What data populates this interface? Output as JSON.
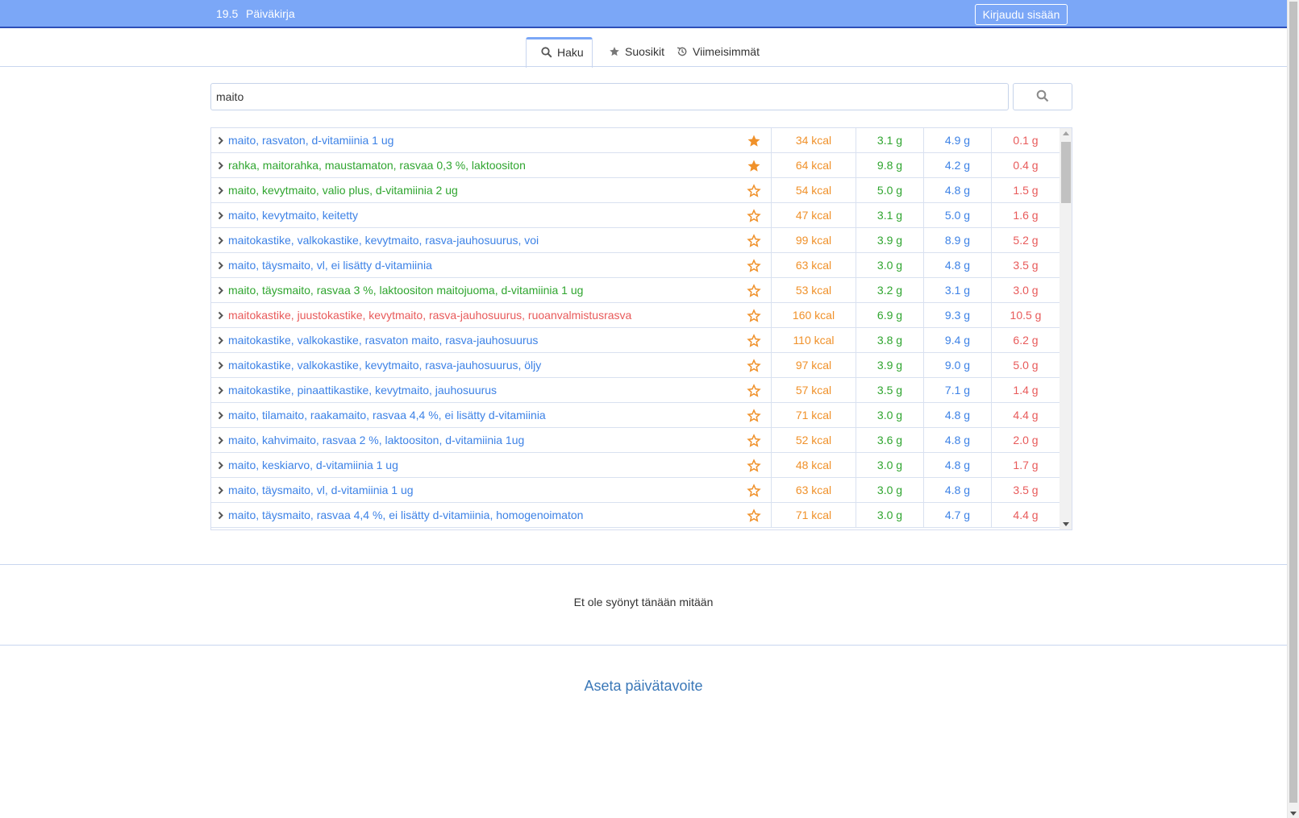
{
  "header": {
    "date": "19.5",
    "title": "Päiväkirja",
    "login_label": "Kirjaudu sisään"
  },
  "tabs": [
    {
      "label": "Haku",
      "icon": "search-icon",
      "active": true
    },
    {
      "label": "Suosikit",
      "icon": "star-icon",
      "active": false
    },
    {
      "label": "Viimeisimmät",
      "icon": "history-icon",
      "active": false
    }
  ],
  "search": {
    "value": "maito"
  },
  "results": [
    {
      "name": "maito, rasvaton, d-vitamiinia 1 ug",
      "color": "blue",
      "favorite": true,
      "kcal": "34 kcal",
      "protein": "3.1 g",
      "carbs": "4.9 g",
      "fat": "0.1 g"
    },
    {
      "name": "rahka, maitorahka, maustamaton, rasvaa 0,3 %, laktoositon",
      "color": "green",
      "favorite": true,
      "kcal": "64 kcal",
      "protein": "9.8 g",
      "carbs": "4.2 g",
      "fat": "0.4 g"
    },
    {
      "name": "maito, kevytmaito, valio plus, d-vitamiinia 2 ug",
      "color": "green",
      "favorite": false,
      "kcal": "54 kcal",
      "protein": "5.0 g",
      "carbs": "4.8 g",
      "fat": "1.5 g"
    },
    {
      "name": "maito, kevytmaito, keitetty",
      "color": "blue",
      "favorite": false,
      "kcal": "47 kcal",
      "protein": "3.1 g",
      "carbs": "5.0 g",
      "fat": "1.6 g"
    },
    {
      "name": "maitokastike, valkokastike, kevytmaito, rasva-jauhosuurus, voi",
      "color": "blue",
      "favorite": false,
      "kcal": "99 kcal",
      "protein": "3.9 g",
      "carbs": "8.9 g",
      "fat": "5.2 g"
    },
    {
      "name": "maito, täysmaito, vl, ei lisätty d-vitamiinia",
      "color": "blue",
      "favorite": false,
      "kcal": "63 kcal",
      "protein": "3.0 g",
      "carbs": "4.8 g",
      "fat": "3.5 g"
    },
    {
      "name": "maito, täysmaito, rasvaa 3 %, laktoositon maitojuoma, d-vitamiinia 1 ug",
      "color": "green",
      "favorite": false,
      "kcal": "53 kcal",
      "protein": "3.2 g",
      "carbs": "3.1 g",
      "fat": "3.0 g"
    },
    {
      "name": "maitokastike, juustokastike, kevytmaito, rasva-jauhosuurus, ruoanvalmistusrasva",
      "color": "red",
      "favorite": false,
      "kcal": "160 kcal",
      "protein": "6.9 g",
      "carbs": "9.3 g",
      "fat": "10.5 g"
    },
    {
      "name": "maitokastike, valkokastike, rasvaton maito, rasva-jauhosuurus",
      "color": "blue",
      "favorite": false,
      "kcal": "110 kcal",
      "protein": "3.8 g",
      "carbs": "9.4 g",
      "fat": "6.2 g"
    },
    {
      "name": "maitokastike, valkokastike, kevytmaito, rasva-jauhosuurus, öljy",
      "color": "blue",
      "favorite": false,
      "kcal": "97 kcal",
      "protein": "3.9 g",
      "carbs": "9.0 g",
      "fat": "5.0 g"
    },
    {
      "name": "maitokastike, pinaattikastike, kevytmaito, jauhosuurus",
      "color": "blue",
      "favorite": false,
      "kcal": "57 kcal",
      "protein": "3.5 g",
      "carbs": "7.1 g",
      "fat": "1.4 g"
    },
    {
      "name": "maito, tilamaito, raakamaito, rasvaa 4,4 %, ei lisätty d-vitamiinia",
      "color": "blue",
      "favorite": false,
      "kcal": "71 kcal",
      "protein": "3.0 g",
      "carbs": "4.8 g",
      "fat": "4.4 g"
    },
    {
      "name": "maito, kahvimaito, rasvaa 2 %, laktoositon, d-vitamiinia 1ug",
      "color": "blue",
      "favorite": false,
      "kcal": "52 kcal",
      "protein": "3.6 g",
      "carbs": "4.8 g",
      "fat": "2.0 g"
    },
    {
      "name": "maito, keskiarvo, d-vitamiinia 1 ug",
      "color": "blue",
      "favorite": false,
      "kcal": "48 kcal",
      "protein": "3.0 g",
      "carbs": "4.8 g",
      "fat": "1.7 g"
    },
    {
      "name": "maito, täysmaito, vl, d-vitamiinia 1 ug",
      "color": "blue",
      "favorite": false,
      "kcal": "63 kcal",
      "protein": "3.0 g",
      "carbs": "4.8 g",
      "fat": "3.5 g"
    },
    {
      "name": "maito, täysmaito, rasvaa 4,4 %, ei lisätty d-vitamiinia, homogenoimaton",
      "color": "blue",
      "favorite": false,
      "kcal": "71 kcal",
      "protein": "3.0 g",
      "carbs": "4.7 g",
      "fat": "4.4 g"
    }
  ],
  "diary": {
    "empty_message": "Et ole syönyt tänään mitään",
    "goal_link": "Aseta päivätavoite"
  },
  "colors": {
    "header": "#7ba7f7",
    "kcal": "#f0912a",
    "protein": "#2fa52f",
    "carbs": "#3d82e6",
    "fat": "#e85a5a",
    "star": "#f0912a"
  }
}
